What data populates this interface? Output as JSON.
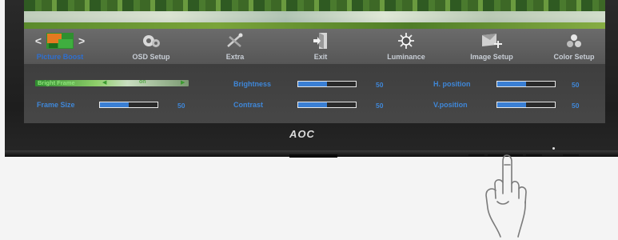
{
  "monitor": {
    "brand": "AOC"
  },
  "menu": {
    "items": [
      {
        "label": "Picture Boost",
        "icon": "picture-boost-icon",
        "active": true
      },
      {
        "label": "OSD Setup",
        "icon": "osd-setup-icon"
      },
      {
        "label": "Extra",
        "icon": "extra-icon"
      },
      {
        "label": "Exit",
        "icon": "exit-icon"
      },
      {
        "label": "Luminance",
        "icon": "luminance-icon"
      },
      {
        "label": "Image Setup",
        "icon": "image-setup-icon"
      },
      {
        "label": "Color Setup",
        "icon": "color-setup-icon"
      }
    ],
    "left_arrow": "<",
    "right_arrow": ">"
  },
  "picture_boost": {
    "bright_frame": {
      "label": "Bright Frame",
      "value": "on",
      "arrow_left": "◀",
      "arrow_right": "▶"
    },
    "frame_size": {
      "label": "Frame Size",
      "value": "50",
      "fill": 0.5
    },
    "brightness": {
      "label": "Brightness",
      "value": "50",
      "fill": 0.5
    },
    "contrast": {
      "label": "Contrast",
      "value": "50",
      "fill": 0.5
    },
    "h_position": {
      "label": "H. position",
      "value": "50",
      "fill": 0.5
    },
    "v_position": {
      "label": "V.position",
      "value": "50",
      "fill": 0.5
    }
  },
  "colors": {
    "label_blue": "#3f87d8",
    "active_menu_blue": "#2e6fd0",
    "selector_green": "#8ee27a"
  }
}
